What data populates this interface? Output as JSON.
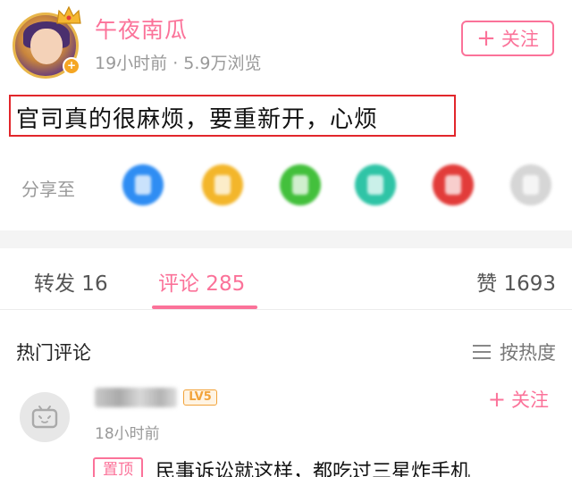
{
  "post": {
    "author_name": "午夜南瓜",
    "time": "19小时前",
    "views": "5.9万浏览",
    "separator": "·",
    "follow_label": "关注",
    "text": "官司真的很麻烦，要重新开，心烦"
  },
  "share": {
    "label": "分享至",
    "icons": [
      "qq-icon",
      "qzone-icon",
      "wechat-icon",
      "moments-icon",
      "weibo-icon",
      "more-icon"
    ]
  },
  "tabs": {
    "repost": "转发 16",
    "comments": "评论 285",
    "likes": "赞 1693"
  },
  "comments_section": {
    "hot_label": "热门评论",
    "sort_label": "按热度"
  },
  "comment": {
    "level": "LV5",
    "time": "18小时前",
    "follow_label": "关注",
    "pinned_label": "置顶",
    "text": "民事诉讼就这样，都吃过三星炸手机"
  },
  "colors": {
    "accent": "#fb7299",
    "highlight_border": "#e2262b",
    "level_badge": "#f2a33a"
  }
}
